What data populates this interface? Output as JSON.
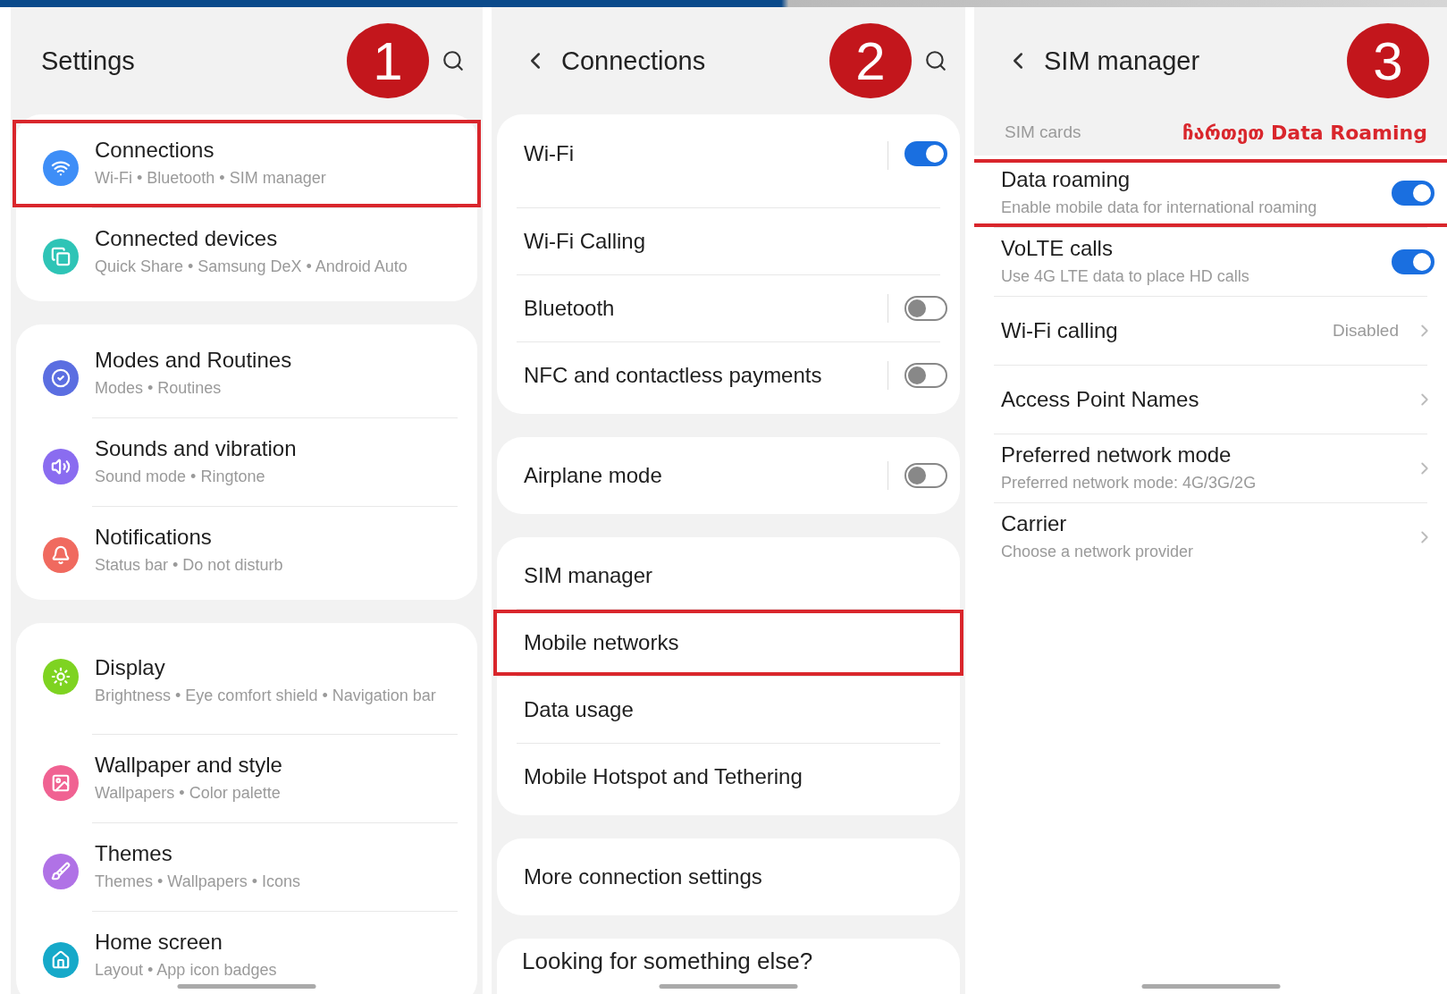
{
  "panels": [
    {
      "step": "1",
      "title": "Settings",
      "back": false,
      "search": true,
      "groups": [
        {
          "items": [
            {
              "kind": "app",
              "label": "Connections",
              "subtitle": "Wi-Fi • Bluetooth • SIM manager",
              "color": "#3e8ef7",
              "highlighted": true
            },
            {
              "kind": "app",
              "label": "Connected devices",
              "subtitle": "Quick Share • Samsung DeX • Android Auto",
              "color": "#2ec4b6",
              "highlighted": false
            }
          ]
        },
        {
          "items": [
            {
              "kind": "app",
              "label": "Modes and Routines",
              "subtitle": "Modes • Routines",
              "color": "#5b6ee1",
              "highlighted": false
            },
            {
              "kind": "app",
              "label": "Sounds and vibration",
              "subtitle": "Sound mode • Ringtone",
              "color": "#8a6cf0",
              "highlighted": false
            },
            {
              "kind": "app",
              "label": "Notifications",
              "subtitle": "Status bar • Do not disturb",
              "color": "#f06a5f",
              "highlighted": false
            }
          ]
        },
        {
          "items": [
            {
              "kind": "app",
              "label": "Display",
              "subtitle": "Brightness • Eye comfort shield • Navigation bar",
              "color": "#7ed321",
              "highlighted": false
            },
            {
              "kind": "app",
              "label": "Wallpaper and style",
              "subtitle": "Wallpapers • Color palette",
              "color": "#f06292",
              "highlighted": false
            },
            {
              "kind": "app",
              "label": "Themes",
              "subtitle": "Themes • Wallpapers • Icons",
              "color": "#b072e6",
              "highlighted": false
            },
            {
              "kind": "app",
              "label": "Home screen",
              "subtitle": "Layout • App icon badges",
              "color": "#16a9c9",
              "highlighted": false
            }
          ]
        }
      ]
    },
    {
      "step": "2",
      "title": "Connections",
      "back": true,
      "search": true,
      "groups": [
        {
          "items": [
            {
              "kind": "toggle",
              "label": "Wi-Fi",
              "on": true,
              "highlighted": false
            },
            {
              "kind": "plain",
              "label": "Wi-Fi Calling",
              "highlighted": false
            },
            {
              "kind": "toggle",
              "label": "Bluetooth",
              "on": false,
              "highlighted": false
            },
            {
              "kind": "toggle",
              "label": "NFC and contactless payments",
              "on": false,
              "highlighted": false
            }
          ]
        },
        {
          "items": [
            {
              "kind": "toggle",
              "label": "Airplane mode",
              "on": false,
              "highlighted": false
            }
          ]
        },
        {
          "items": [
            {
              "kind": "plain",
              "label": "SIM manager",
              "highlighted": false
            },
            {
              "kind": "plain",
              "label": "Mobile networks",
              "highlighted": true
            },
            {
              "kind": "plain",
              "label": "Data usage",
              "highlighted": false
            },
            {
              "kind": "plain",
              "label": "Mobile Hotspot and Tethering",
              "highlighted": false
            }
          ]
        },
        {
          "items": [
            {
              "kind": "plain",
              "label": "More connection settings",
              "highlighted": false
            }
          ]
        }
      ],
      "footer": "Looking for something else?"
    },
    {
      "step": "3",
      "title": "SIM manager",
      "back": true,
      "search": false,
      "section": "SIM cards",
      "note": "ჩართეთ Data Roaming",
      "groups": [
        {
          "items": [
            {
              "kind": "toggle",
              "label": "Data roaming",
              "subtitle": "Enable mobile data for international roaming",
              "on": true,
              "highlighted": true
            },
            {
              "kind": "toggle",
              "label": "VoLTE calls",
              "subtitle": "Use 4G LTE data to place HD calls",
              "on": true,
              "highlighted": false
            },
            {
              "kind": "link",
              "label": "Wi-Fi calling",
              "value": "Disabled",
              "highlighted": false
            },
            {
              "kind": "link",
              "label": "Access Point Names",
              "highlighted": false
            },
            {
              "kind": "link",
              "label": "Preferred network mode",
              "subtitle": "Preferred network mode: 4G/3G/2G",
              "highlighted": false
            },
            {
              "kind": "link",
              "label": "Carrier",
              "subtitle": "Choose a network provider",
              "highlighted": false
            }
          ]
        }
      ]
    }
  ]
}
